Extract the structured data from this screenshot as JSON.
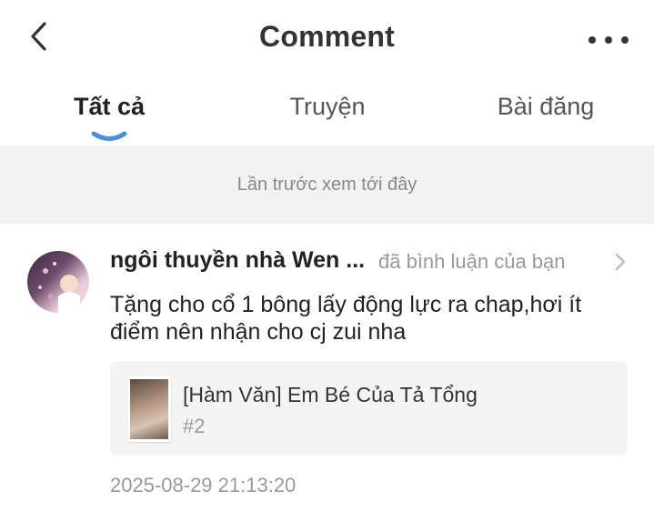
{
  "header": {
    "title": "Comment",
    "back_icon": "chevron-left-icon",
    "more_icon": "more-horizontal-icon"
  },
  "tabs": [
    {
      "label": "Tất cả",
      "active": true
    },
    {
      "label": "Truyện",
      "active": false
    },
    {
      "label": "Bài đăng",
      "active": false
    }
  ],
  "accent_color": "#4a90e2",
  "last_seen_label": "Lần trước xem tới đây",
  "comment": {
    "username": "ngôi thuyền nhà Wen ...",
    "action": "đã bình luận của bạn",
    "text": "Tặng cho cổ 1 bông lấy động lực ra chap,hơi ít điểm nên nhận cho cj zui nha",
    "story": {
      "title": "[Hàm Văn] Em Bé Của Tả Tổng",
      "chapter": "#2"
    },
    "timestamp": "2025-08-29 21:13:20"
  }
}
